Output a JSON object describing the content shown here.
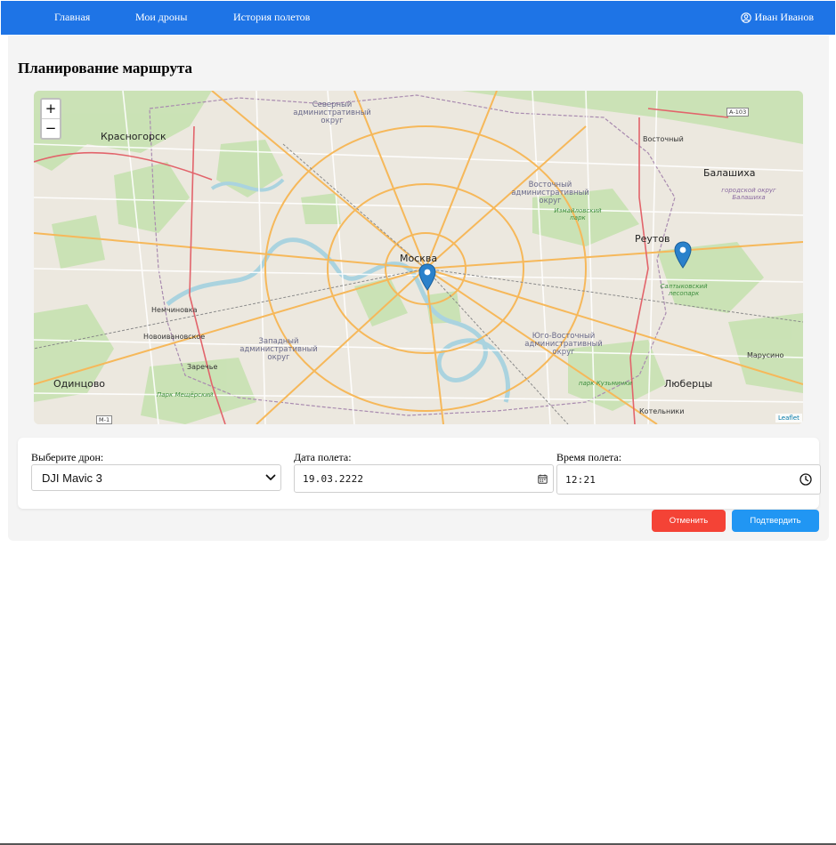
{
  "nav": {
    "links": [
      "Главная",
      "Мои дроны",
      "История полетов"
    ],
    "user": "Иван Иванов",
    "user_icon": "user-circle-icon"
  },
  "page": {
    "title": "Планирование маршрута"
  },
  "map": {
    "zoom_in": "+",
    "zoom_out": "−",
    "attribution": "Leaflet",
    "labels": {
      "krasnogorsk": "Красногорск",
      "moskva": "Москва",
      "reutov": "Реутов",
      "balashikha": "Балашиха",
      "vostochny": "Восточный",
      "nemchinovka": "Немчиновка",
      "novoivanovskoe": "Новоивановское",
      "zarechye": "Заречье",
      "odintsovo": "Одинцово",
      "lyubertsy": "Люберцы",
      "marusino": "Марусино",
      "kotelniki": "Котельники",
      "sev_okrug": "Северный административный округ",
      "vost_okrug": "Восточный административный округ",
      "zap_okrug": "Западный административный округ",
      "yv_okrug": "Юго-Восточный административный округ",
      "izmailovsky": "Измайловский парк",
      "saltykovsky": "Салтыковский лесопарк",
      "balashikha_okrug": "городской округ Балашиха",
      "park_meshchersky": "Парк Мещёрский",
      "park_kuzminki": "парк Кузьминки",
      "a103": "А-103",
      "m1": "М-1"
    }
  },
  "form": {
    "drone_label": "Выберите дрон:",
    "drone_value": "DJI Mavic 3",
    "date_label": "Дата полета:",
    "date_value": "19.03.2222",
    "time_label": "Время полета:",
    "time_value": "12:21"
  },
  "buttons": {
    "cancel": "Отменить",
    "confirm": "Подтвердить"
  },
  "colors": {
    "nav": "#1e74e6",
    "cancel": "#f44336",
    "confirm": "#2196f3",
    "marker": "#2a81cb"
  }
}
